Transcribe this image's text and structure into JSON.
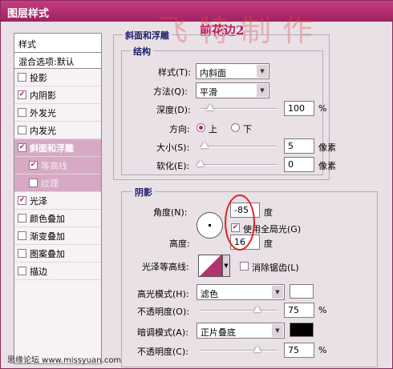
{
  "window_title": "图层样式",
  "watermark_text": "飞特制作",
  "overlay_text": "前花边2",
  "left_panel": {
    "header": "样式",
    "blend_options": "混合选项:默认",
    "items": [
      {
        "label": "投影",
        "checked": false
      },
      {
        "label": "内阴影",
        "checked": true
      },
      {
        "label": "外发光",
        "checked": false
      },
      {
        "label": "内发光",
        "checked": false
      },
      {
        "label": "斜面和浮雕",
        "checked": true
      },
      {
        "label": "等高线",
        "checked": true
      },
      {
        "label": "纹理",
        "checked": false
      },
      {
        "label": "光泽",
        "checked": true
      },
      {
        "label": "颜色叠加",
        "checked": false
      },
      {
        "label": "渐变叠加",
        "checked": false
      },
      {
        "label": "图案叠加",
        "checked": false
      },
      {
        "label": "描边",
        "checked": false
      }
    ]
  },
  "bevel": {
    "title": "斜面和浮雕",
    "structure_title": "结构",
    "style_label": "样式(T):",
    "style_value": "内斜面",
    "technique_label": "方法(Q):",
    "technique_value": "平滑",
    "depth_label": "深度(D):",
    "depth_value": "100",
    "depth_unit": "%",
    "direction_label": "方向:",
    "direction_up": "上",
    "direction_down": "下",
    "size_label": "大小(S):",
    "size_value": "5",
    "size_unit": "像素",
    "soften_label": "软化(E):",
    "soften_value": "0",
    "soften_unit": "像素"
  },
  "shading": {
    "title": "阴影",
    "angle_label": "角度(N):",
    "angle_value": "-85",
    "angle_unit": "度",
    "global_light_label": "使用全局光(G)",
    "altitude_label": "高度:",
    "altitude_value": "16",
    "altitude_unit": "度",
    "gloss_label": "光泽等高线:",
    "antialias_label": "消除锯齿(L)",
    "highlight_label": "高光模式(H):",
    "highlight_value": "滤色",
    "highlight_color": "#ffffff",
    "highlight_opacity_label": "不透明度(O):",
    "highlight_opacity_value": "75",
    "shadow_label": "暗调模式(A):",
    "shadow_value": "正片叠底",
    "shadow_color": "#000000",
    "shadow_opacity_label": "不透明度(C):",
    "shadow_opacity_value": "75",
    "percent": "%"
  },
  "footer": "思缘论坛 www.missyuan.com"
}
